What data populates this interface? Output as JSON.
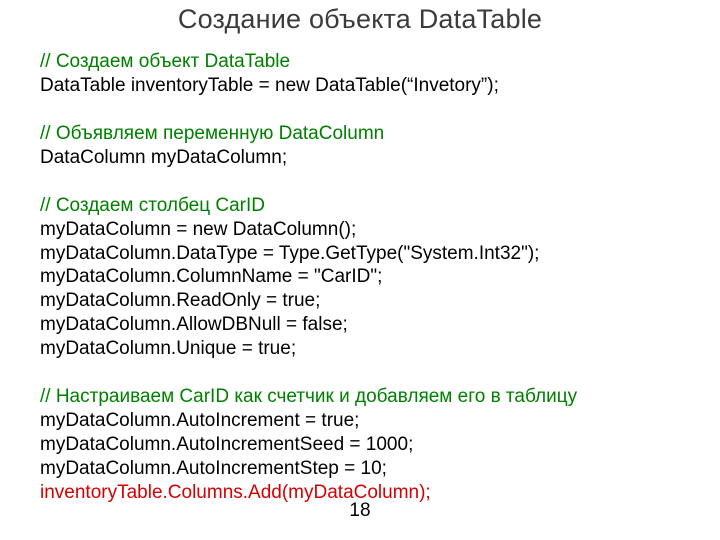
{
  "title": "Создание объекта DataTable",
  "pageNumber": "18",
  "lines": [
    {
      "text": "// Создаем объект DataTable",
      "cls": "comment"
    },
    {
      "text": "DataTable inventoryTable = new DataTable(“Invetory”);",
      "cls": ""
    },
    {
      "text": "",
      "cls": ""
    },
    {
      "text": "// Объявляем переменную DataColumn",
      "cls": "comment"
    },
    {
      "text": "DataColumn myDataColumn;",
      "cls": ""
    },
    {
      "text": "",
      "cls": ""
    },
    {
      "text": "// Создаем столбец CarID",
      "cls": "comment"
    },
    {
      "text": "myDataColumn = new DataColumn();",
      "cls": ""
    },
    {
      "text": "myDataColumn.DataType = Type.GetType(\"System.Int32\");",
      "cls": ""
    },
    {
      "text": "myDataColumn.ColumnName = \"CarID\";",
      "cls": ""
    },
    {
      "text": "myDataColumn.ReadOnly = true;",
      "cls": ""
    },
    {
      "text": "myDataColumn.AllowDBNull = false;",
      "cls": ""
    },
    {
      "text": "myDataColumn.Unique = true;",
      "cls": ""
    },
    {
      "text": "",
      "cls": ""
    },
    {
      "text": "// Настраиваем CarID как счетчик и добавляем его в таблицу",
      "cls": "comment"
    },
    {
      "text": "myDataColumn.AutoIncrement = true;",
      "cls": ""
    },
    {
      "text": "myDataColumn.AutoIncrementSeed = 1000;",
      "cls": ""
    },
    {
      "text": "myDataColumn.AutoIncrementStep = 10;",
      "cls": ""
    },
    {
      "text": "inventoryTable.Columns.Add(myDataColumn);",
      "cls": "highlight"
    }
  ]
}
